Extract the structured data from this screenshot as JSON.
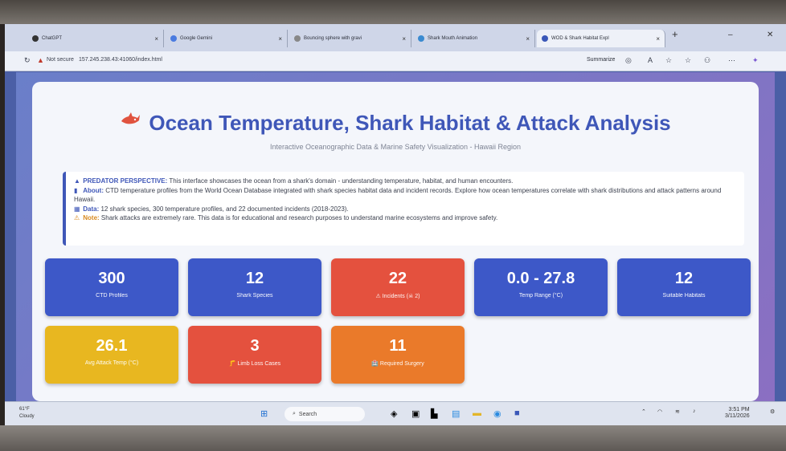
{
  "browser": {
    "tabs": [
      {
        "label": "ChatGPT",
        "color": "#333333"
      },
      {
        "label": "Google Gemini",
        "color": "#4a7be0"
      },
      {
        "label": "Bouncing sphere with gravi",
        "color": "#888888"
      },
      {
        "label": "Shark Mouth Animation",
        "color": "#3a8ad0"
      },
      {
        "label": "WOD & Shark Habitat Expl",
        "color": "#3a57b8"
      }
    ],
    "new_tab": "+",
    "minimize": "–",
    "close": "✕",
    "not_secure": "Not secure",
    "url": "157.245.238.43:41060/index.html",
    "summarize_label": "Summarize"
  },
  "page": {
    "title": "Ocean Temperature, Shark Habitat & Attack Analysis",
    "subtitle": "Interactive Oceanographic Data & Marine Safety Visualization - Hawaii Region",
    "info": {
      "predator_label": "PREDATOR PERSPECTIVE:",
      "predator_text": "This interface showcases the ocean from a shark's domain - understanding temperature, habitat, and human encounters.",
      "about_label": "About:",
      "about_text": "CTD temperature profiles from the World Ocean Database integrated with shark species habitat data and incident records. Explore how ocean temperatures correlate with shark distributions and attack patterns around Hawaii.",
      "data_label": "Data:",
      "data_text": "12 shark species, 300 temperature profiles, and 22 documented incidents (2018-2023).",
      "note_label": "Note:",
      "note_text": "Shark attacks are extremely rare. This data is for educational and research purposes to understand marine ecosystems and improve safety."
    },
    "stats": [
      {
        "value": "300",
        "label": "CTD Profiles",
        "color": "#3d58c8"
      },
      {
        "value": "12",
        "label": "Shark Species",
        "color": "#3d58c8"
      },
      {
        "value": "22",
        "label": "⚠ Incidents (☠ 2)",
        "color": "#e4513e"
      },
      {
        "value": "0.0 - 27.8",
        "label": "Temp Range (°C)",
        "color": "#3d58c8"
      },
      {
        "value": "12",
        "label": "Suitable Habitats",
        "color": "#3d58c8"
      },
      {
        "value": "26.1",
        "label": "Avg Attack Temp (°C)",
        "color": "#e8b720"
      },
      {
        "value": "3",
        "label": "🦵 Limb Loss Cases",
        "color": "#e4513e"
      },
      {
        "value": "11",
        "label": "🏥 Required Surgery",
        "color": "#ea7a2a"
      }
    ]
  },
  "taskbar": {
    "weather_temp": "61°F",
    "weather_desc": "Cloudy",
    "search_placeholder": "Search",
    "time": "3:51 PM",
    "date": "3/11/2026"
  }
}
